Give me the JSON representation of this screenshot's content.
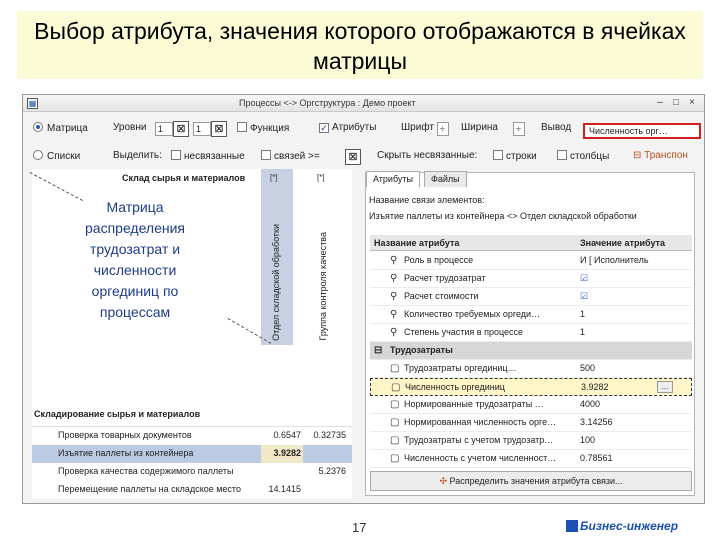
{
  "slide": {
    "title": "Выбор атрибута, значения которого отображаются в ячейках матрицы",
    "page_number": "17",
    "brand": "Бизнес-инженер"
  },
  "window": {
    "title": "Процессы <-> Оргструктура : Демо проект",
    "minimize": "–",
    "maximize": "□",
    "close": "×"
  },
  "toolbar1": {
    "matrix_radio": "Матрица",
    "levels_label": "Уровни",
    "level_from": "1",
    "level_to": "1",
    "function_cb": "Функция",
    "attributes_cb": "Атрибуты",
    "font_label": "Шрифт",
    "width_label": "Ширина",
    "view_label": "Вывод",
    "view_select": "Численность орг…"
  },
  "toolbar2": {
    "lists_radio": "Списки",
    "select_label": "Выделить:",
    "unlinked_cb": "несвязанные",
    "links_cb": "связей >=",
    "hide_unlinked": "Скрыть несвязанные:",
    "rows_cb": "строки",
    "columns_cb": "столбцы",
    "transpose": "Транспон"
  },
  "matrix": {
    "corner_title": "Склад сырья и материалов",
    "columns": [
      {
        "label": "Отдел складской обработки",
        "mark": "[*]"
      },
      {
        "label": "Группа контроля качества",
        "mark": "[*]"
      }
    ],
    "overlay_note": "Матрица распределения трудозатрат и численности оргединиц по процессам",
    "group_label": "Складирование сырья и материалов",
    "rows": [
      {
        "label": "Проверка товарных документов",
        "v1": "0.6547",
        "v2": "0.32735"
      },
      {
        "label": "Изъятие паллеты из контейнера",
        "v1": "3.9282",
        "v2": ""
      },
      {
        "label": "Проверка качества содержимого паллеты",
        "v1": "",
        "v2": "5.2376"
      },
      {
        "label": "Перемещение паллеты на складское место",
        "v1": "14.1415",
        "v2": ""
      }
    ]
  },
  "panel": {
    "tab_attributes": "Атрибуты",
    "tab_files": "Файлы",
    "info1": "Название связи элементов:",
    "info2": "Изъятие паллеты из контейнера <> Отдел складской обработки",
    "col_name": "Название атрибута",
    "col_value": "Значение атрибута",
    "attributes": [
      {
        "name": "Роль в процессе",
        "value": "И  [ Исполнитель",
        "icon": "⚲"
      },
      {
        "name": "Расчет трудозатрат",
        "value": "☑",
        "icon": "⚲"
      },
      {
        "name": "Расчет стоимости",
        "value": "☑",
        "icon": "⚲"
      },
      {
        "name": "Количество требуемых оргеди…",
        "value": "1",
        "icon": "⚲"
      },
      {
        "name": "Степень участия в процессе",
        "value": "1",
        "icon": "⚲"
      }
    ],
    "group_name": "Трудозатраты",
    "group_rows": [
      {
        "name": "Трудозатраты оргединиц…",
        "value": "500",
        "icon": "▢"
      },
      {
        "name": "Численность оргединиц",
        "value": "3.9282",
        "icon": "▢"
      },
      {
        "name": "Нормированные трудозатраты …",
        "value": "4000",
        "icon": "▢"
      },
      {
        "name": "Нормированная численность орге…",
        "value": "3.14256",
        "icon": "▢"
      },
      {
        "name": "Трудозатраты с учетом трудозатр…",
        "value": "100",
        "icon": "▢"
      },
      {
        "name": "Численность с учетом численност…",
        "value": "0.78561",
        "icon": "▢"
      }
    ],
    "ellipsis": "...",
    "distribute_button": "Распределить значения атрибута связи..."
  }
}
